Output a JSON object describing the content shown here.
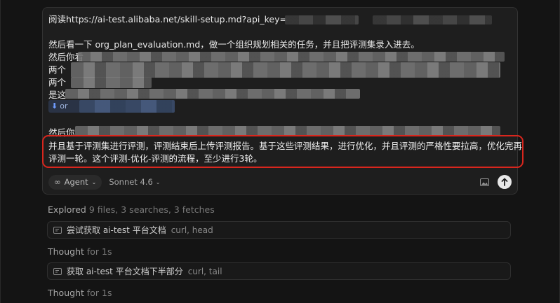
{
  "message": {
    "line1_prefix": "阅读https://ai-test.alibaba.net/skill-setup.md?api_key=",
    "line2": "然后看一下 org_plan_evaluation.md，做一个组织规划相关的任务，并且把评测集录入进去。",
    "line3_prefix": "然后你看",
    "line4_prefix": "两个",
    "line5_prefix": "两个",
    "line6_prefix": "是这",
    "chip_prefix": "or",
    "line7_prefix": "然后你",
    "highlight_line1": "并且基于评测集进行评测，评测结束后上传评测报告。基于这些评测结果，进行优化，并且评测的严格性要拉高，优化完再",
    "highlight_line2": "评测一轮。这个评测-优化-评测的流程，至少进行3轮。"
  },
  "toolbar": {
    "agent_label": "Agent",
    "model_label": "Sonnet 4.6"
  },
  "activity": {
    "explored_label": "Explored",
    "explored_detail": "9 files, 3 searches, 3 fetches",
    "thought1_label": "Thought",
    "thought1_detail": "for 1s",
    "tool1_label": "尝试获取 ai-test 平台文档",
    "tool1_detail": "curl, head",
    "tool2_label": "获取 ai-test 平台文档下半部分",
    "tool2_detail": "curl, tail",
    "thought2_label": "Thought",
    "thought2_detail": "for 1s"
  },
  "colors": {
    "highlight_border": "#d8261d",
    "background": "#141414",
    "composer": "#1e1e1e"
  }
}
